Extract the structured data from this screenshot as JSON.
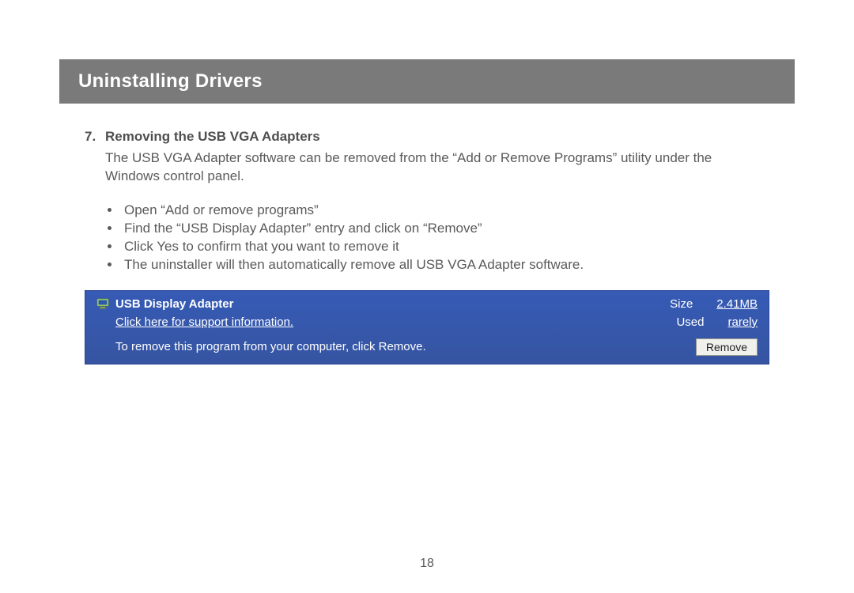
{
  "header": {
    "title": "Uninstalling Drivers"
  },
  "section": {
    "number": "7.",
    "heading": "Removing the USB VGA Adapters",
    "paragraph": "The USB VGA Adapter software can be removed from the “Add or Remove Programs” utility under the Windows control panel.",
    "bullets": [
      "Open “Add or remove programs”",
      "Find the “USB Display Adapter” entry and click on “Remove”",
      "Click Yes to confirm that you want to remove it",
      "The uninstaller will then automatically remove all USB VGA Adapter software."
    ]
  },
  "programPanel": {
    "name": "USB Display Adapter",
    "size_label": "Size",
    "size_value": "2.41MB",
    "support_text": "Click here for support information.",
    "used_label": "Used",
    "used_value": "rarely",
    "remove_text": "To remove this program from your computer, click Remove.",
    "remove_button": "Remove"
  },
  "page_number": "18"
}
